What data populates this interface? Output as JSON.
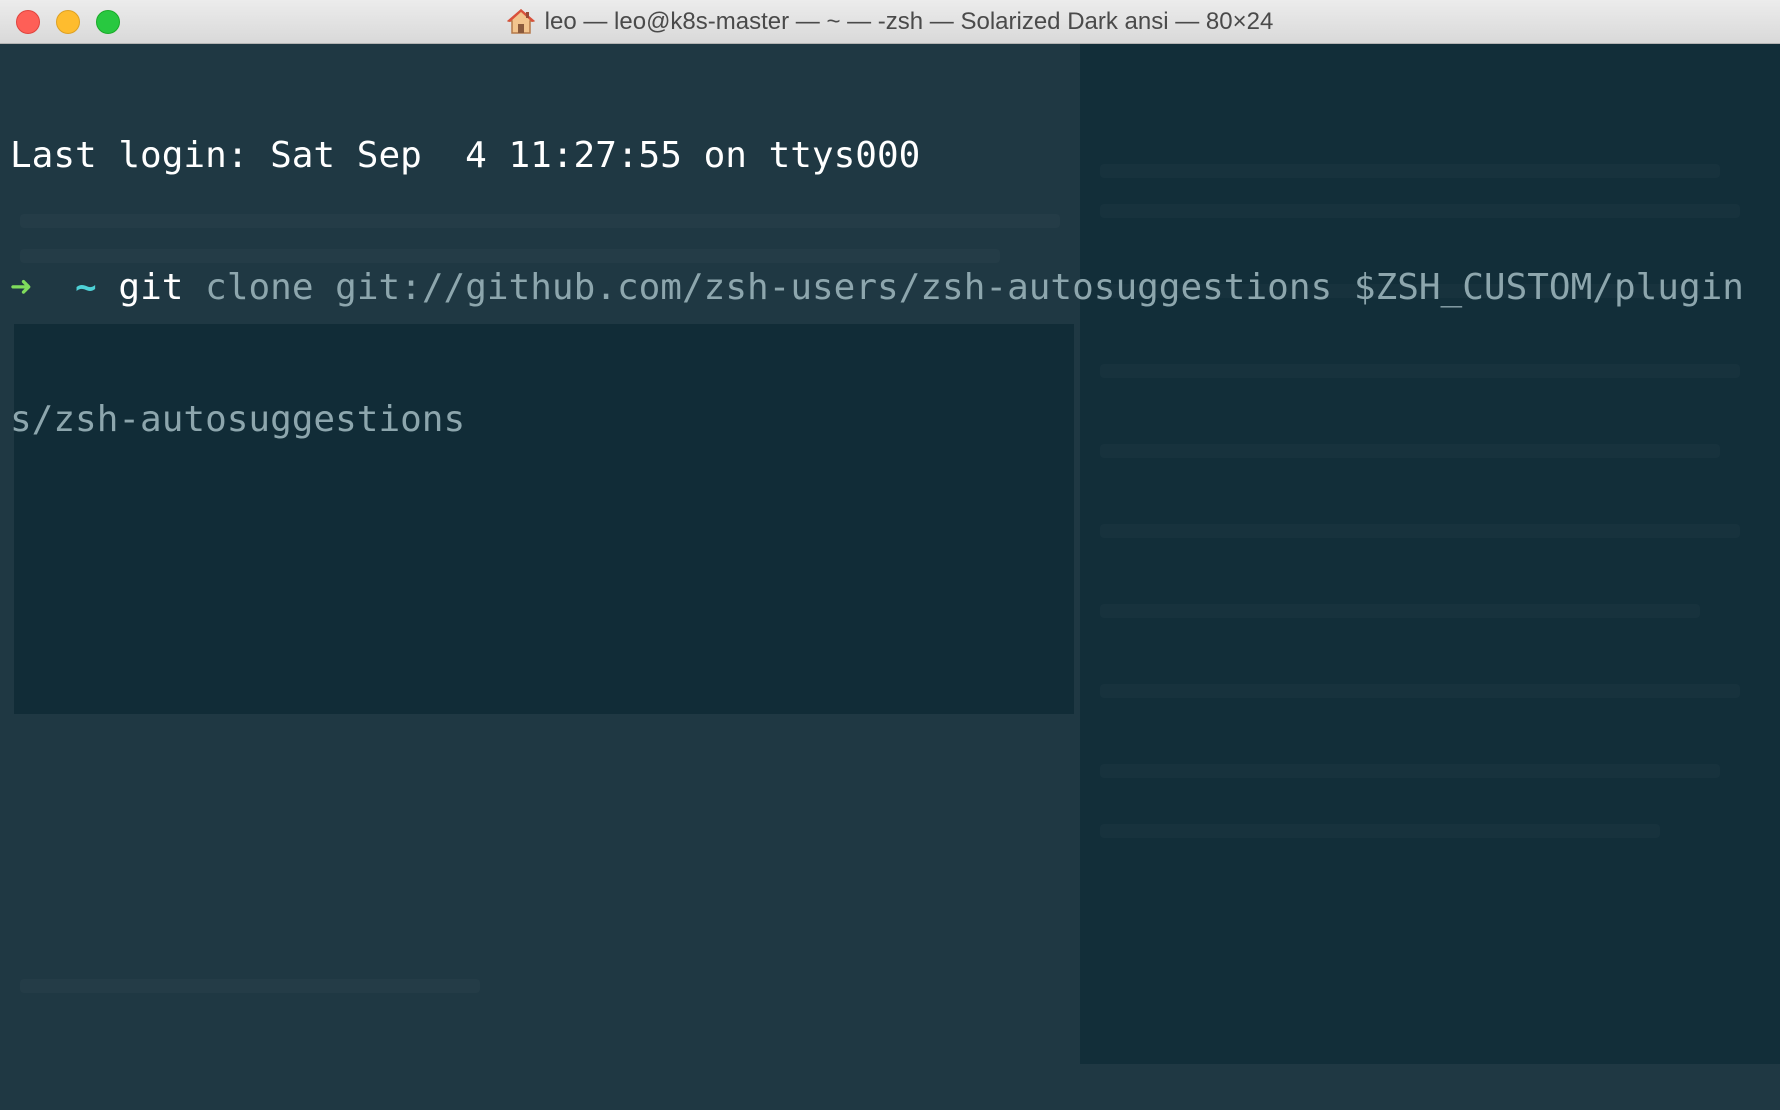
{
  "window": {
    "title": "leo — leo@k8s-master — ~ — -zsh — Solarized Dark ansi — 80×24",
    "icon": "home-icon",
    "buttons": [
      "close",
      "minimize",
      "zoom"
    ]
  },
  "terminal": {
    "last_login": "Last login: Sat Sep  4 11:27:55 on ttys000",
    "prompt_arrow": "➜",
    "prompt_dir": "~",
    "command": "git",
    "suggestion_line1": "clone git://github.com/zsh-users/zsh-autosuggestions $ZSH_CUSTOM/plugin",
    "suggestion_line2": "s/zsh-autosuggestions"
  },
  "colors": {
    "background": "#1f3843",
    "prompt_arrow": "#7fdb5c",
    "prompt_dir": "#4ed1d6",
    "autosuggestion": "#8da6ad",
    "text": "#ffffff"
  }
}
